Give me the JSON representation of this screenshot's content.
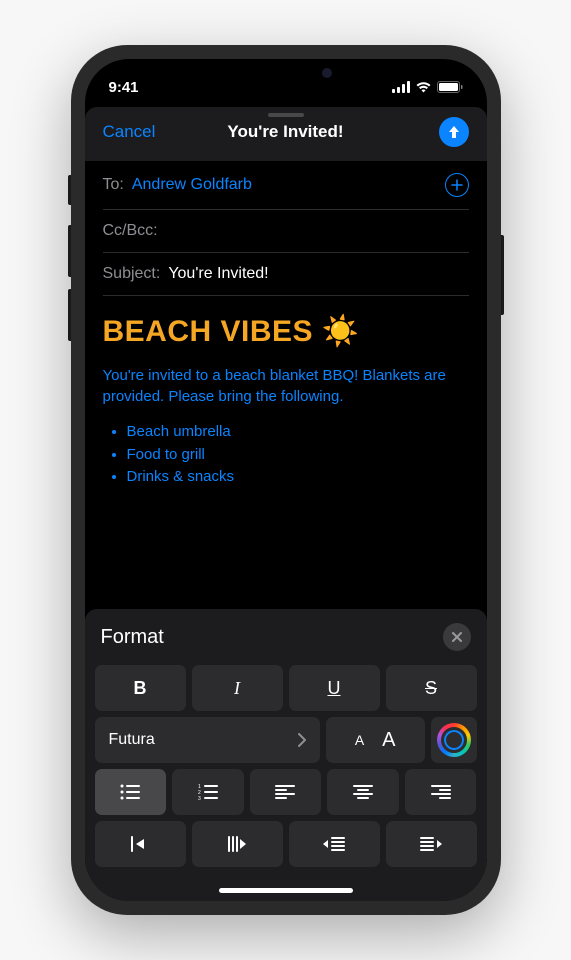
{
  "status_bar": {
    "time": "9:41"
  },
  "nav": {
    "cancel": "Cancel",
    "title": "You're Invited!"
  },
  "compose": {
    "to_label": "To:",
    "to_value": "Andrew Goldfarb",
    "ccbcc_label": "Cc/Bcc:",
    "subject_label": "Subject:",
    "subject_value": "You're Invited!"
  },
  "body": {
    "heading": "BEACH VIBES ☀️",
    "paragraph": "You're invited to a beach blanket BBQ! Blankets are provided. Please bring the following.",
    "list": {
      "0": "Beach umbrella",
      "1": "Food to grill",
      "2": "Drinks & snacks"
    }
  },
  "format": {
    "title": "Format",
    "bold": "B",
    "italic": "I",
    "underline": "U",
    "strike": "S",
    "font_name": "Futura",
    "small_a": "A",
    "big_a": "A"
  }
}
